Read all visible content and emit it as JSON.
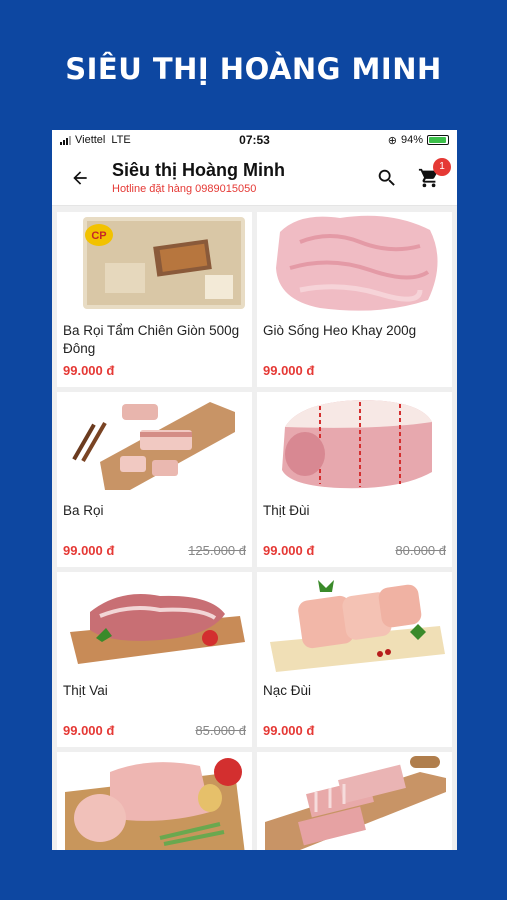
{
  "banner": "SIÊU THỊ HOÀNG MINH",
  "status": {
    "carrier": "Viettel",
    "network": "LTE",
    "time": "07:53",
    "battery": "94%",
    "battery_level": 0.94
  },
  "header": {
    "title": "Siêu thị Hoàng Minh",
    "hotline": "Hotline đặt hàng 0989015050",
    "cart_count": "1"
  },
  "products": [
    {
      "name": "Ba Rọi Tẩm Chiên Giòn 500g Đông",
      "price": "99.000 đ",
      "old_price": "",
      "image": "packaged-pork-belly-image",
      "brand": "CP"
    },
    {
      "name": "Giò Sống Heo Khay 200g",
      "price": "99.000 đ",
      "old_price": "",
      "image": "pork-paste-image"
    },
    {
      "name": "Ba Rọi",
      "price": "99.000 đ",
      "old_price": "125.000 đ",
      "image": "pork-belly-image"
    },
    {
      "name": "Thịt Đùi",
      "price": "99.000 đ",
      "old_price": "80.000 đ",
      "image": "pork-leg-image"
    },
    {
      "name": "Thịt Vai",
      "price": "99.000 đ",
      "old_price": "85.000 đ",
      "image": "pork-shoulder-image"
    },
    {
      "name": "Nạc Đùi",
      "price": "99.000 đ",
      "old_price": "",
      "image": "lean-pork-leg-image"
    },
    {
      "name": "",
      "price": "",
      "old_price": "",
      "image": "pork-loin-image"
    },
    {
      "name": "",
      "price": "",
      "old_price": "",
      "image": "pork-ribs-image"
    }
  ],
  "colors": {
    "background": "#0d47a1",
    "price": "#e53935",
    "badge": "#e53935"
  }
}
